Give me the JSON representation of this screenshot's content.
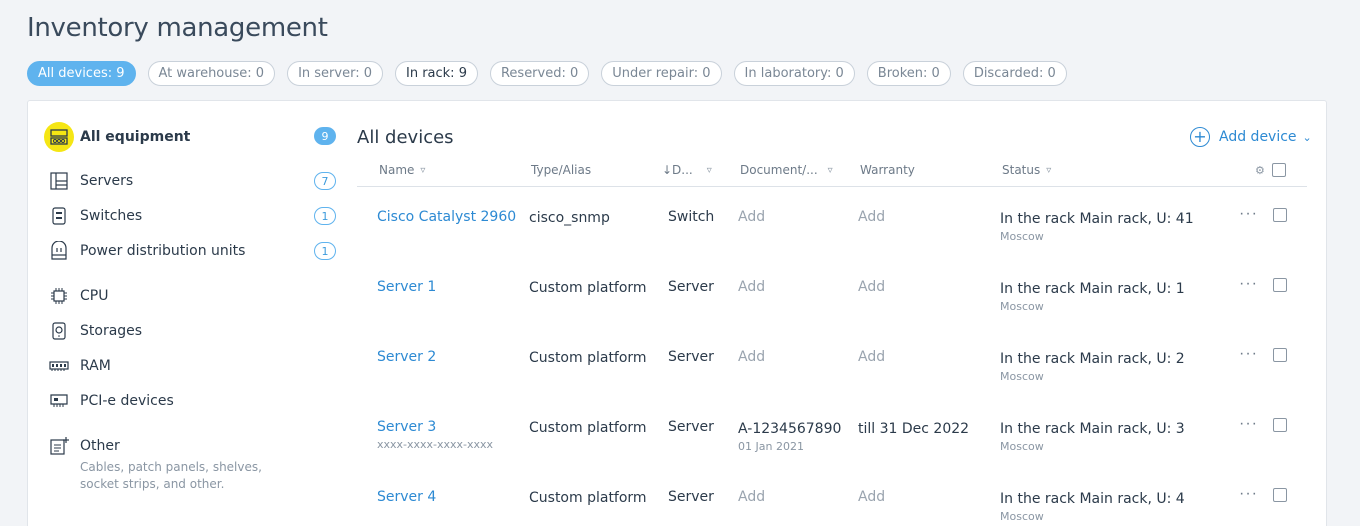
{
  "page": {
    "title": "Inventory management"
  },
  "filters": [
    {
      "label": "All devices: 9",
      "state": "active"
    },
    {
      "label": "At warehouse: 0",
      "state": "normal"
    },
    {
      "label": "In server: 0",
      "state": "normal"
    },
    {
      "label": "In rack: 9",
      "state": "dark"
    },
    {
      "label": "Reserved: 0",
      "state": "normal"
    },
    {
      "label": "Under repair: 0",
      "state": "normal"
    },
    {
      "label": "In laboratory: 0",
      "state": "normal"
    },
    {
      "label": "Broken: 0",
      "state": "normal"
    },
    {
      "label": "Discarded: 0",
      "state": "normal"
    }
  ],
  "sidebar": {
    "all": {
      "label": "All equipment",
      "count": "9",
      "icon": "equipment-icon"
    },
    "items": [
      {
        "label": "Servers",
        "count": "7",
        "icon": "server-icon"
      },
      {
        "label": "Switches",
        "count": "1",
        "icon": "switch-icon"
      },
      {
        "label": "Power distribution units",
        "count": "1",
        "icon": "pdu-icon"
      },
      {
        "label": "CPU",
        "count": "",
        "icon": "cpu-icon"
      },
      {
        "label": "Storages",
        "count": "",
        "icon": "storage-icon"
      },
      {
        "label": "RAM",
        "count": "",
        "icon": "ram-icon"
      },
      {
        "label": "PCI-e devices",
        "count": "",
        "icon": "pcie-icon"
      },
      {
        "label": "Other",
        "count": "",
        "icon": "other-icon"
      }
    ],
    "other_desc": "Cables, patch panels, shelves, socket strips, and other."
  },
  "main": {
    "title": "All devices",
    "add_label": "Add device",
    "columns": {
      "name": "Name",
      "type": "Type/Alias",
      "device": "↓D...",
      "document": "Document/...",
      "warranty": "Warranty",
      "status": "Status"
    },
    "rows": [
      {
        "name": "Cisco Catalyst 2960",
        "serial": "",
        "type": "cisco_snmp",
        "device": "Switch",
        "document": "Add",
        "doc_date": "",
        "warranty": "Add",
        "status": "In the rack Main rack, U: 41",
        "location": "Moscow"
      },
      {
        "name": "Server 1",
        "serial": "",
        "type": "Custom platform",
        "device": "Server",
        "document": "Add",
        "doc_date": "",
        "warranty": "Add",
        "status": "In the rack Main rack, U: 1",
        "location": "Moscow"
      },
      {
        "name": "Server 2",
        "serial": "",
        "type": "Custom platform",
        "device": "Server",
        "document": "Add",
        "doc_date": "",
        "warranty": "Add",
        "status": "In the rack Main rack, U: 2",
        "location": "Moscow"
      },
      {
        "name": "Server 3",
        "serial": "xxxx-xxxx-xxxx-xxxx",
        "type": "Custom platform",
        "device": "Server",
        "document": "A-1234567890",
        "doc_date": "01 Jan 2021",
        "warranty": "till 31 Dec 2022",
        "status": "In the rack Main rack, U: 3",
        "location": "Moscow"
      },
      {
        "name": "Server 4",
        "serial": "",
        "type": "Custom platform",
        "device": "Server",
        "document": "Add",
        "doc_date": "",
        "warranty": "Add",
        "status": "In the rack Main rack, U: 4",
        "location": "Moscow"
      }
    ]
  },
  "colors": {
    "accent": "#5fb3ee",
    "link": "#2d8ad3",
    "highlight": "#f5e614"
  }
}
